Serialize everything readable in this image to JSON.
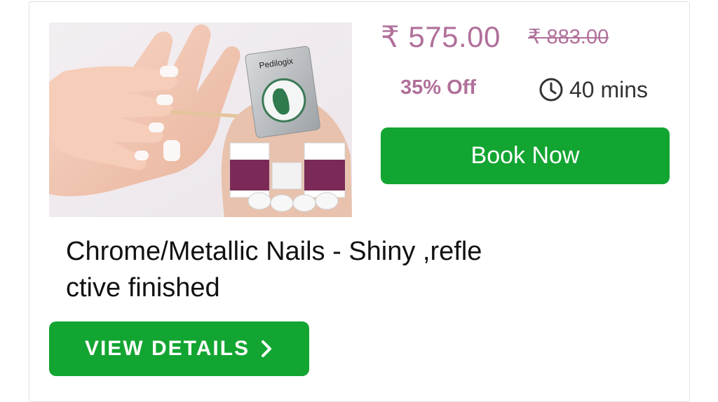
{
  "product": {
    "price_current": "₹ 575.00",
    "price_original": "₹ 883.00",
    "discount": "35% Off",
    "duration": "40 mins",
    "title": "Chrome/Metallic Nails - Shiny ,refle\nctive finished",
    "image": {
      "brand_text": "Pedilogix"
    }
  },
  "actions": {
    "book_now_label": "Book Now",
    "view_details_label": "VIEW DETAILS"
  },
  "icons": {
    "duration": "clock-icon",
    "view_details": "chevron-right-icon"
  },
  "colors": {
    "price": "#b0709a",
    "button_green": "#13a532",
    "card_border": "#e2e2e2"
  }
}
